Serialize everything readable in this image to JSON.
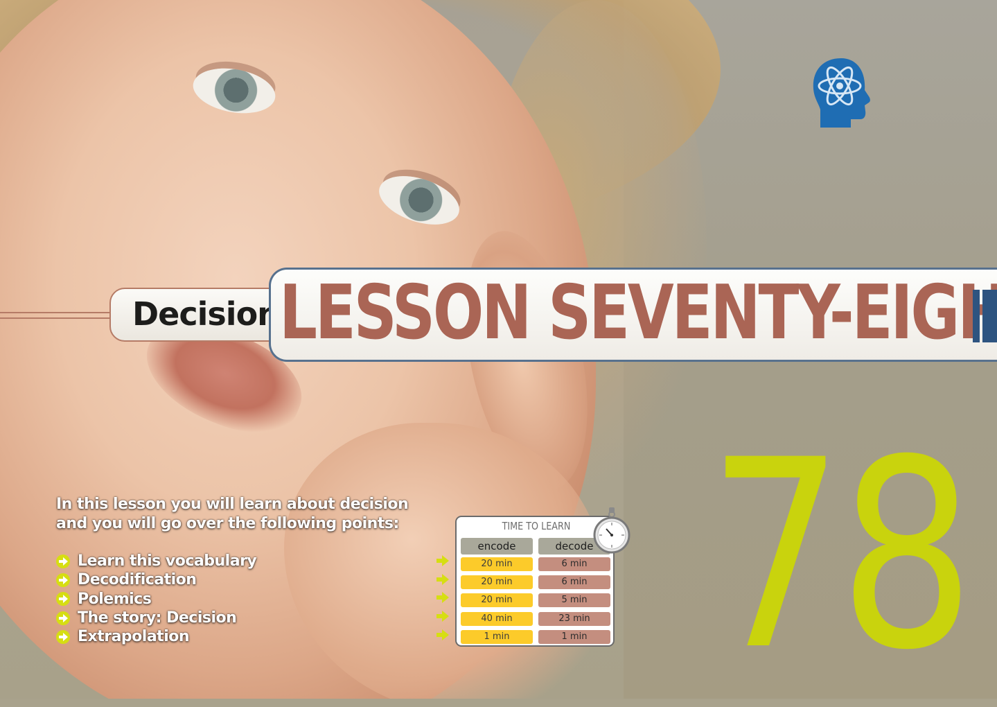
{
  "lesson": {
    "subtitle": "Decision",
    "title": "LESSON SEVENTY-EIGHT",
    "number": "78"
  },
  "intro": {
    "line1": "In this lesson you will learn about decision",
    "line2": "and you will go over the following points:"
  },
  "points": [
    "Learn this vocabulary",
    "Decodification",
    "Polemics",
    "The story: Decision",
    "Extrapolation"
  ],
  "time_to_learn": {
    "title": "TIME TO LEARN",
    "encode_label": "encode",
    "decode_label": "decode",
    "rows": [
      {
        "encode": "20 min",
        "decode": "6 min"
      },
      {
        "encode": "20 min",
        "decode": "6 min"
      },
      {
        "encode": "20 min",
        "decode": "5 min"
      },
      {
        "encode": "40 min",
        "decode": "23 min"
      },
      {
        "encode": "1 min",
        "decode": "1 min"
      }
    ]
  },
  "icons": {
    "logo": "brain-atom-head-icon",
    "bullet": "arrow-right-icon",
    "timer": "stopwatch-icon"
  },
  "colors": {
    "title": "#aa6555",
    "number": "#c9d30d",
    "banner_border": "#57718e",
    "encode": "#fccb2a",
    "decode": "#c48e7f",
    "bullet": "#d6de12"
  }
}
